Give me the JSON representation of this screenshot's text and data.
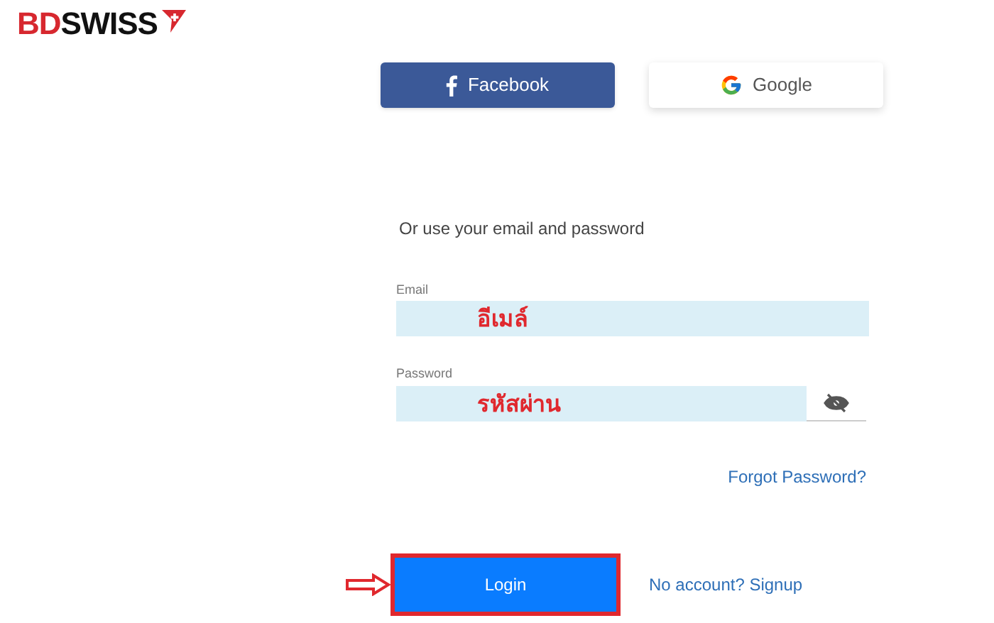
{
  "logo": {
    "parts": [
      "BD",
      "SWISS"
    ]
  },
  "social_buttons": [
    {
      "kind": "facebook",
      "label": "Facebook"
    },
    {
      "kind": "google",
      "label": "Google"
    }
  ],
  "intro": "Or use your email and password",
  "fields": [
    {
      "kind": "email",
      "label": "Email",
      "value": "อีเมล์",
      "annotated": true
    },
    {
      "kind": "password",
      "label": "Password",
      "value": "รหัสผ่าน",
      "annotated": true
    }
  ],
  "forgot_link": "Forgot Password?",
  "login_button": {
    "label": "Login",
    "highlighted": true
  },
  "signup_link": "No account? Signup"
}
